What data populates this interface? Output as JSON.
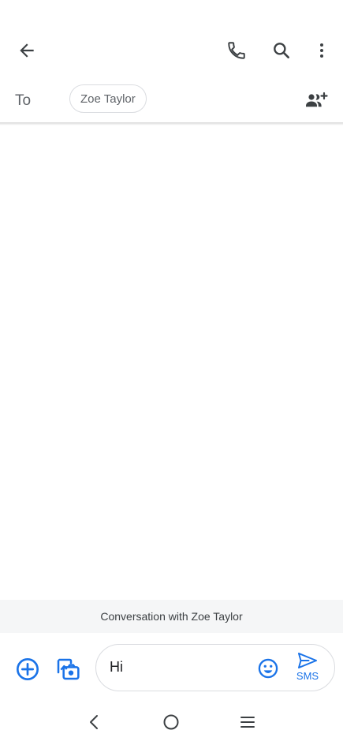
{
  "header": {
    "back_icon": "arrow-back-icon",
    "call_icon": "phone-icon",
    "search_icon": "search-icon",
    "more_icon": "more-vert-icon"
  },
  "recipient": {
    "to_label": "To",
    "chip_name": "Zoe Taylor",
    "add_icon": "add-people-icon"
  },
  "conversation": {
    "banner_text": "Conversation with Zoe Taylor"
  },
  "compose": {
    "plus_icon": "add-circle-icon",
    "gallery_icon": "gallery-camera-icon",
    "message_value": "Hi",
    "emoji_icon": "emoji-icon",
    "send_icon": "send-icon",
    "send_label": "SMS"
  },
  "navbar": {
    "back_icon": "nav-back-icon",
    "home_icon": "nav-home-icon",
    "recents_icon": "nav-recents-icon"
  },
  "colors": {
    "accent": "#1a73e8",
    "icon_dark": "#3c4043",
    "banner_bg": "#f5f6f7",
    "chip_border": "#dadce0"
  }
}
